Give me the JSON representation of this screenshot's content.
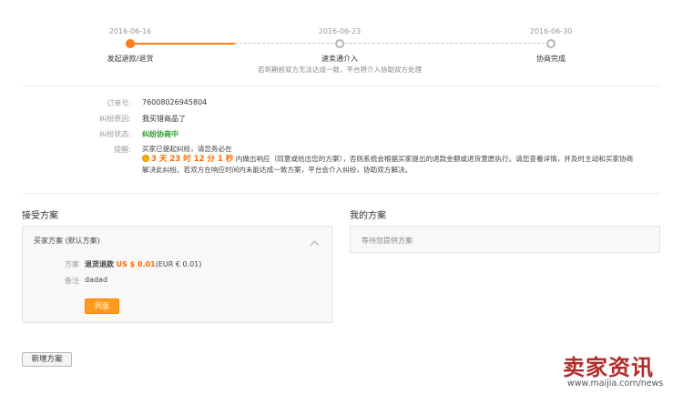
{
  "progress": {
    "steps": [
      {
        "date": "2016-06-16",
        "label": "发起退款/退货"
      },
      {
        "date": "2016-06-23",
        "label": "速卖通介入"
      },
      {
        "date": "2016-06-30",
        "label": "协商完成"
      }
    ],
    "hint": "若到期前双方无法达成一致，平台将介入协助双方处理",
    "colors": {
      "active": "#ff7a1a",
      "inactive": "#b5b5b5"
    }
  },
  "dispute": {
    "order_label": "订单号:",
    "order_value": "76008026945804",
    "reason_label": "纠纷原因:",
    "reason_value": "我买错商品了",
    "status_label": "纠纷状态:",
    "status_value": "纠纷协商中",
    "reminder_label": "提醒:",
    "reminder_line1": "买家已提起纠纷，请您务必在",
    "countdown": "3 天 23 时 12 分 1 秒",
    "reminder_line2": "内做出响应（同意或给出您的方案），否则系统会根据买家提出的退款金额或退货意愿执行。请您查看详情，并及时主动和买家协商",
    "reminder_line3": "解决此纠纷。若双方在响应时间内未能达成一致方案，平台会介入纠纷，协助双方解决。"
  },
  "accept": {
    "title": "接受方案",
    "panel_title": "买家方案 (默认方案)",
    "plan_label": "方案",
    "plan_type": "退货退款",
    "plan_price": "US $ 0.01",
    "plan_eur": "(EUR € 0.01)",
    "note_label": "备注",
    "note_value": "dadad",
    "agree_button": "同意"
  },
  "mine": {
    "title": "我的方案",
    "waiting": "等待您提供方案"
  },
  "new_plan_button": "新增方案",
  "watermark": {
    "brand": "卖家资讯",
    "url": "www.maijia.com/news"
  }
}
